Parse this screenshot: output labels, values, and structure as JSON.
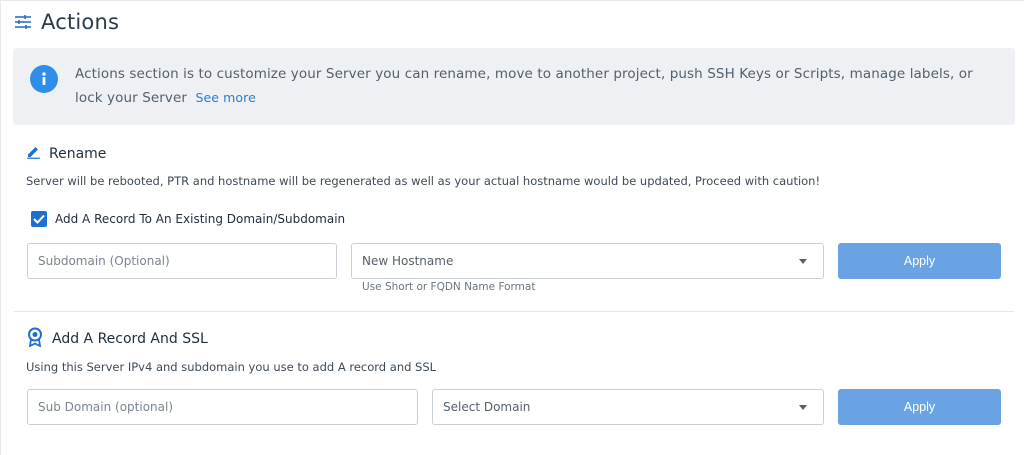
{
  "header": {
    "title": "Actions",
    "icon": "sliders-icon"
  },
  "info": {
    "icon": "info-icon",
    "text": "Actions section is to customize your Server you can rename, move to another project, push SSH Keys or Scripts, manage labels, or lock your Server",
    "link": "See more",
    "accent": "#2f8ee8"
  },
  "rename": {
    "icon": "pencil-icon",
    "title": "Rename",
    "description": "Server will be rebooted, PTR and hostname will be regenerated as well as your actual hostname would be updated, Proceed with caution!",
    "checkbox_label": "Add A Record To An Existing Domain/Subdomain",
    "checkbox_checked": true,
    "subdomain_placeholder": "Subdomain (Optional)",
    "hostname_placeholder": "New Hostname",
    "hostname_hint": "Use Short or FQDN Name Format",
    "apply_label": "Apply"
  },
  "ssl": {
    "icon": "badge-icon",
    "title": "Add A Record And SSL",
    "description": "Using this Server IPv4 and subdomain you use to add A record and SSL",
    "subdomain_placeholder": "Sub Domain (optional)",
    "domain_placeholder": "Select Domain",
    "apply_label": "Apply"
  },
  "colors": {
    "button": "#6aa3e3",
    "checkbox": "#1f6fd0",
    "link": "#2a7fd4"
  }
}
